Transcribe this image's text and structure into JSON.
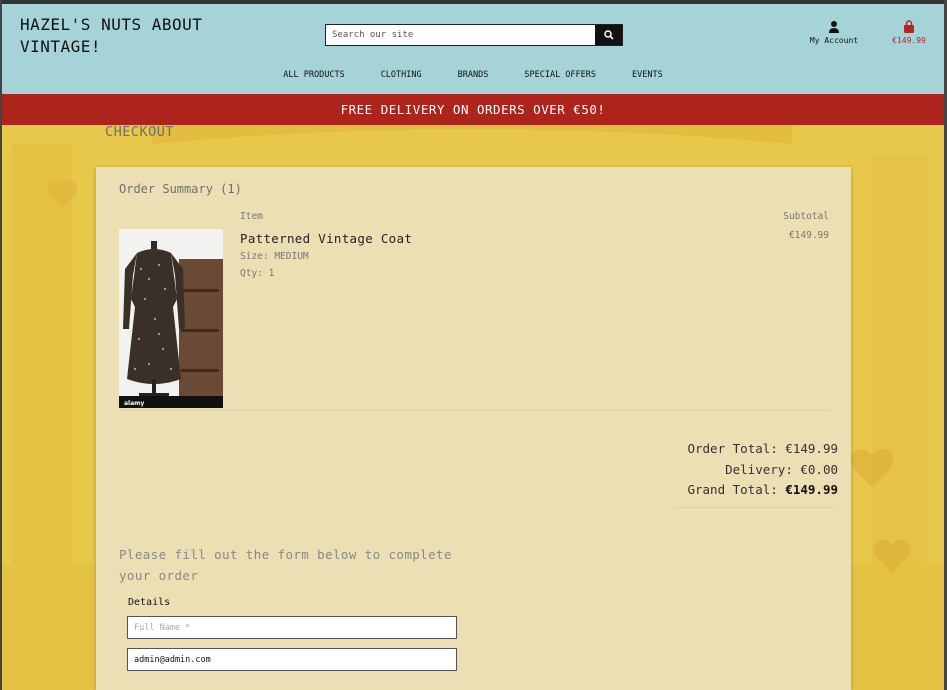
{
  "header": {
    "logo": "HAZEL'S NUTS ABOUT VINTAGE!",
    "search_placeholder": "Search our site",
    "account_label": "My Account",
    "cart_total": "€149.99"
  },
  "nav": [
    {
      "label": "ALL PRODUCTS"
    },
    {
      "label": "CLOTHING"
    },
    {
      "label": "BRANDS"
    },
    {
      "label": "SPECIAL OFFERS"
    },
    {
      "label": "EVENTS"
    }
  ],
  "banner": "FREE DELIVERY ON ORDERS OVER €50!",
  "page_title": "CHECKOUT",
  "summary": {
    "title": "Order Summary (1)",
    "col_item": "Item",
    "col_subtotal": "Subtotal",
    "items": [
      {
        "name": "Patterned Vintage Coat",
        "size": "Size: MEDIUM",
        "qty": "Qty: 1",
        "subtotal": "€149.99",
        "image_caption": "alamy"
      }
    ],
    "order_total": "Order Total: €149.99",
    "delivery": "Delivery: €0.00",
    "grand_total_label": "Grand Total: ",
    "grand_total_value": "€149.99"
  },
  "form": {
    "intro": "Please fill out the form below to complete your order",
    "details_label": "Details",
    "full_name_placeholder": "Full Name *",
    "email_value": "admin@admin.com"
  },
  "colors": {
    "header_bg": "#a6d3d7",
    "banner_bg": "#ad241d",
    "page_bg": "#e8c84a",
    "card_bg": "#eddfb4",
    "cart_accent": "#b8251e"
  }
}
